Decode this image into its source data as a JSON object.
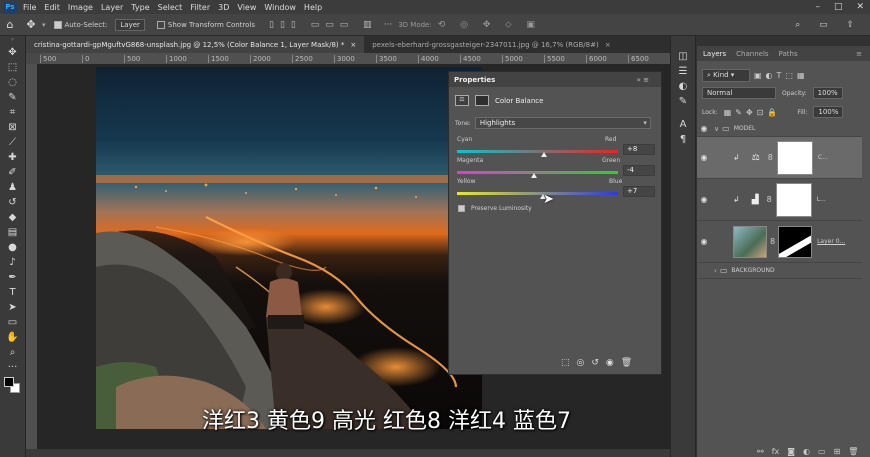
{
  "app": {
    "logo": "Ps"
  },
  "menu": [
    "File",
    "Edit",
    "Image",
    "Layer",
    "Type",
    "Select",
    "Filter",
    "3D",
    "View",
    "Window",
    "Help"
  ],
  "window_controls": [
    "–",
    "□",
    "✕"
  ],
  "options_bar": {
    "auto_select_label": "Auto-Select:",
    "auto_select_target": "Layer",
    "transform_controls_label": "Show Transform Controls",
    "mode_3d": "3D Mode:"
  },
  "tabs": [
    {
      "label": "cristina-gottardi-gpMguftvG868-unsplash.jpg @ 12,5% (Color Balance 1, Layer Mask/8) *"
    },
    {
      "label": "pexels-eberhard-grossgasteiger-2347011.jpg @ 16,7% (RGB/8#)"
    }
  ],
  "ruler_ticks": [
    "500",
    "0",
    "500",
    "1000",
    "1500",
    "2000",
    "2500",
    "3000",
    "3500",
    "4000",
    "4500",
    "5000",
    "5500",
    "6000",
    "6500"
  ],
  "properties": {
    "title": "Properties",
    "adjustment_name": "Color Balance",
    "tone_label": "Tone:",
    "tone_value": "Highlights",
    "sliders": [
      {
        "left": "Cyan",
        "right": "Red",
        "value": "+8",
        "level": 8
      },
      {
        "left": "Magenta",
        "right": "Green",
        "value": "-4",
        "level": -4
      },
      {
        "left": "Yellow",
        "right": "Blue",
        "value": "+7",
        "level": 7
      }
    ],
    "preserve_luminosity_label": "Preserve Luminosity",
    "preserve_luminosity_checked": true
  },
  "layers_panel": {
    "tabs": [
      "Layers",
      "Channels",
      "Paths"
    ],
    "filter_kind": "Kind",
    "blend_mode": "Normal",
    "opacity_label": "Opacity:",
    "opacity_value": "100%",
    "lock_label": "Lock:",
    "fill_label": "Fill:",
    "fill_value": "100%",
    "groups": [
      {
        "name": "MODEL"
      },
      {
        "name": "BACKGROUND"
      }
    ],
    "layers": [
      {
        "name": "C..."
      },
      {
        "name": "L..."
      },
      {
        "name": "Layer 0..."
      }
    ]
  },
  "caption": "洋红3 黄色9 高光 红色8 洋红4 蓝色7",
  "colors": {
    "accent": "#31a8ff",
    "panel": "#535353",
    "menubar": "#3c3c3c"
  }
}
